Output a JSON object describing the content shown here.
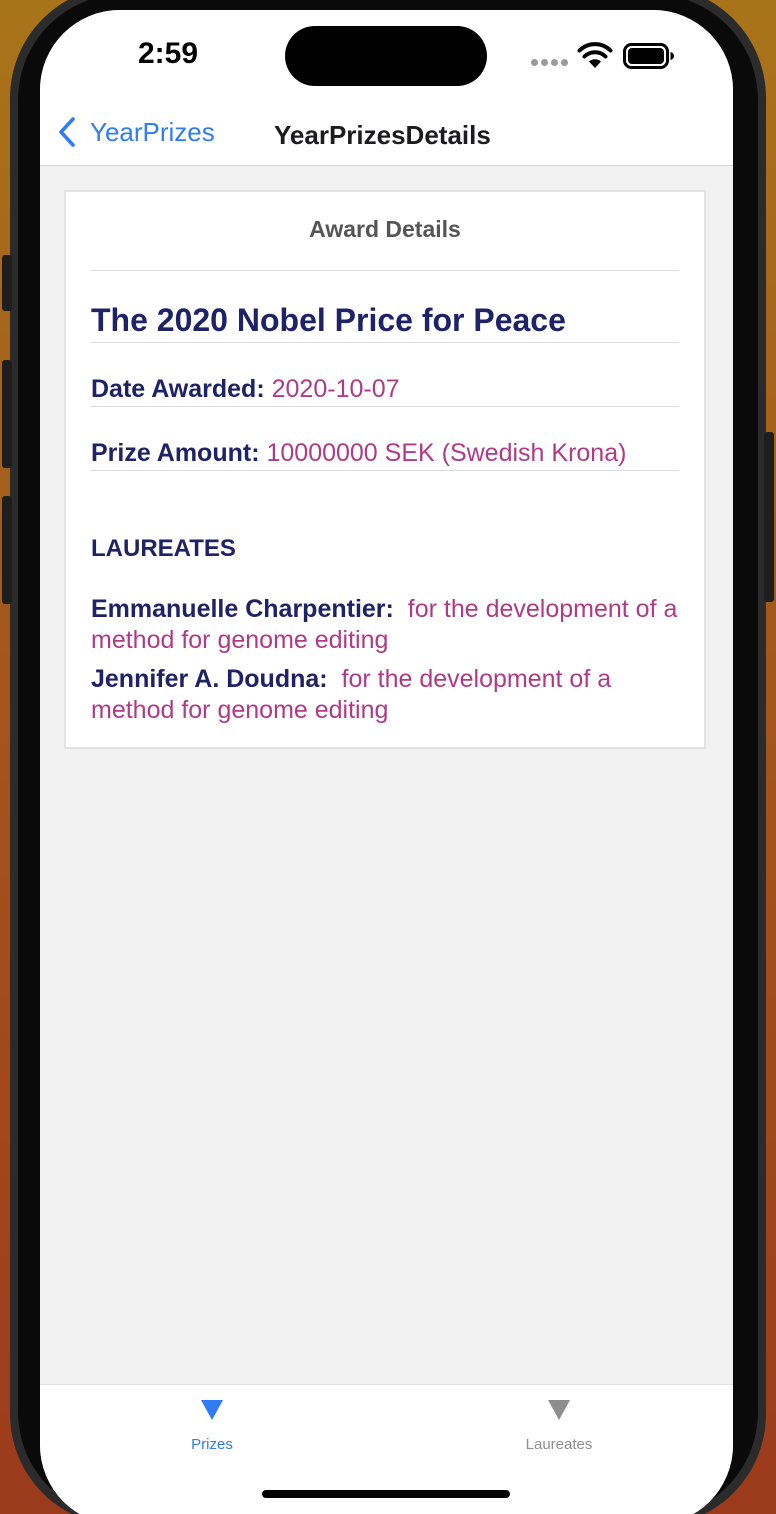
{
  "status": {
    "time": "2:59"
  },
  "nav": {
    "back_label": "YearPrizes",
    "title": "YearPrizesDetails"
  },
  "card": {
    "header": "Award Details",
    "prize_title": "The 2020 Nobel Price for Peace",
    "date_label": "Date Awarded:",
    "date_value": "2020-10-07",
    "amount_label": "Prize Amount:",
    "amount_value": "10000000 SEK (Swedish Krona)",
    "laureates_heading": "LAUREATES",
    "laureates": [
      {
        "name": "Emmanuelle Charpentier:",
        "motivation": "for the development of a method for genome editing"
      },
      {
        "name": "Jennifer A. Doudna:",
        "motivation": "for the development of a method for genome editing"
      }
    ]
  },
  "tabs": [
    {
      "label": "Prizes",
      "icon": "triangle-down-icon",
      "active": true
    },
    {
      "label": "Laureates",
      "icon": "triangle-down-icon",
      "active": false
    }
  ],
  "colors": {
    "accent": "#2f7cf6",
    "label": "#1e2266",
    "value": "#b03a86",
    "inactive_tab": "#8e8e8e"
  }
}
